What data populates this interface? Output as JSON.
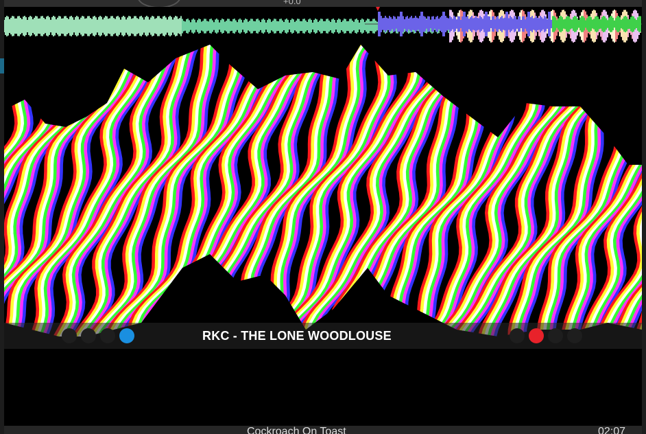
{
  "now_playing": {
    "title": "RKC - THE LONE WOODLOUSE"
  },
  "background_app": {
    "top_readout": "+0.0",
    "next_track": "Cockroach On Toast",
    "next_track_time": "02:07"
  },
  "left_dots": [
    {
      "name": "left-dot-1",
      "color": "#1e1e1e"
    },
    {
      "name": "left-dot-2",
      "color": "#1e1e1e"
    },
    {
      "name": "left-dot-3",
      "color": "#1e1e1e"
    },
    {
      "name": "left-dot-4",
      "color": "#1a8fe0"
    }
  ],
  "right_dots": [
    {
      "name": "right-dot-1",
      "color": "#1e1e1e"
    },
    {
      "name": "right-dot-2",
      "color": "#e8222a"
    },
    {
      "name": "right-dot-3",
      "color": "#1e1e1e"
    },
    {
      "name": "right-dot-4",
      "color": "#1e1e1e"
    }
  ],
  "colors": {
    "accent_blue": "#1a8fe0",
    "accent_red": "#e8222a",
    "wave_green": "#7fe0a8",
    "wave_blue": "#6b63e8"
  }
}
